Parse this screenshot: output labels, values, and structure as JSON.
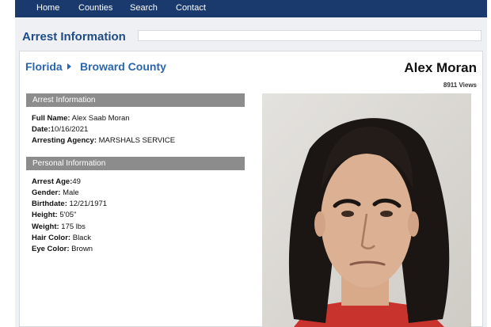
{
  "nav": {
    "items": [
      "Home",
      "Counties",
      "Search",
      "Contact"
    ],
    "background": "#1a3a6e"
  },
  "page": {
    "section_title": "Arrest Information",
    "accent_color": "#2a66b0"
  },
  "breadcrumb": {
    "state": "Florida",
    "county": "Broward County"
  },
  "person": {
    "name": "Alex Moran",
    "views": "8911 Views"
  },
  "arrest_info": {
    "header": "Arrest Information",
    "fields": [
      {
        "label": "Full Name:",
        "value": " Alex Saab Moran"
      },
      {
        "label": "Date:",
        "value": "10/16/2021"
      },
      {
        "label": "Arresting Agency:",
        "value": " MARSHALS SERVICE"
      }
    ]
  },
  "personal_info": {
    "header": "Personal Information",
    "fields": [
      {
        "label": "Arrest Age:",
        "value": "49"
      },
      {
        "label": "Gender:",
        "value": " Male"
      },
      {
        "label": "Birthdate:",
        "value": " 12/21/1971"
      },
      {
        "label": "Height:",
        "value": " 5'05\""
      },
      {
        "label": "Weight:",
        "value": " 175 lbs"
      },
      {
        "label": "Hair Color:",
        "value": " Black"
      },
      {
        "label": "Eye Color:",
        "value": " Brown"
      }
    ]
  }
}
